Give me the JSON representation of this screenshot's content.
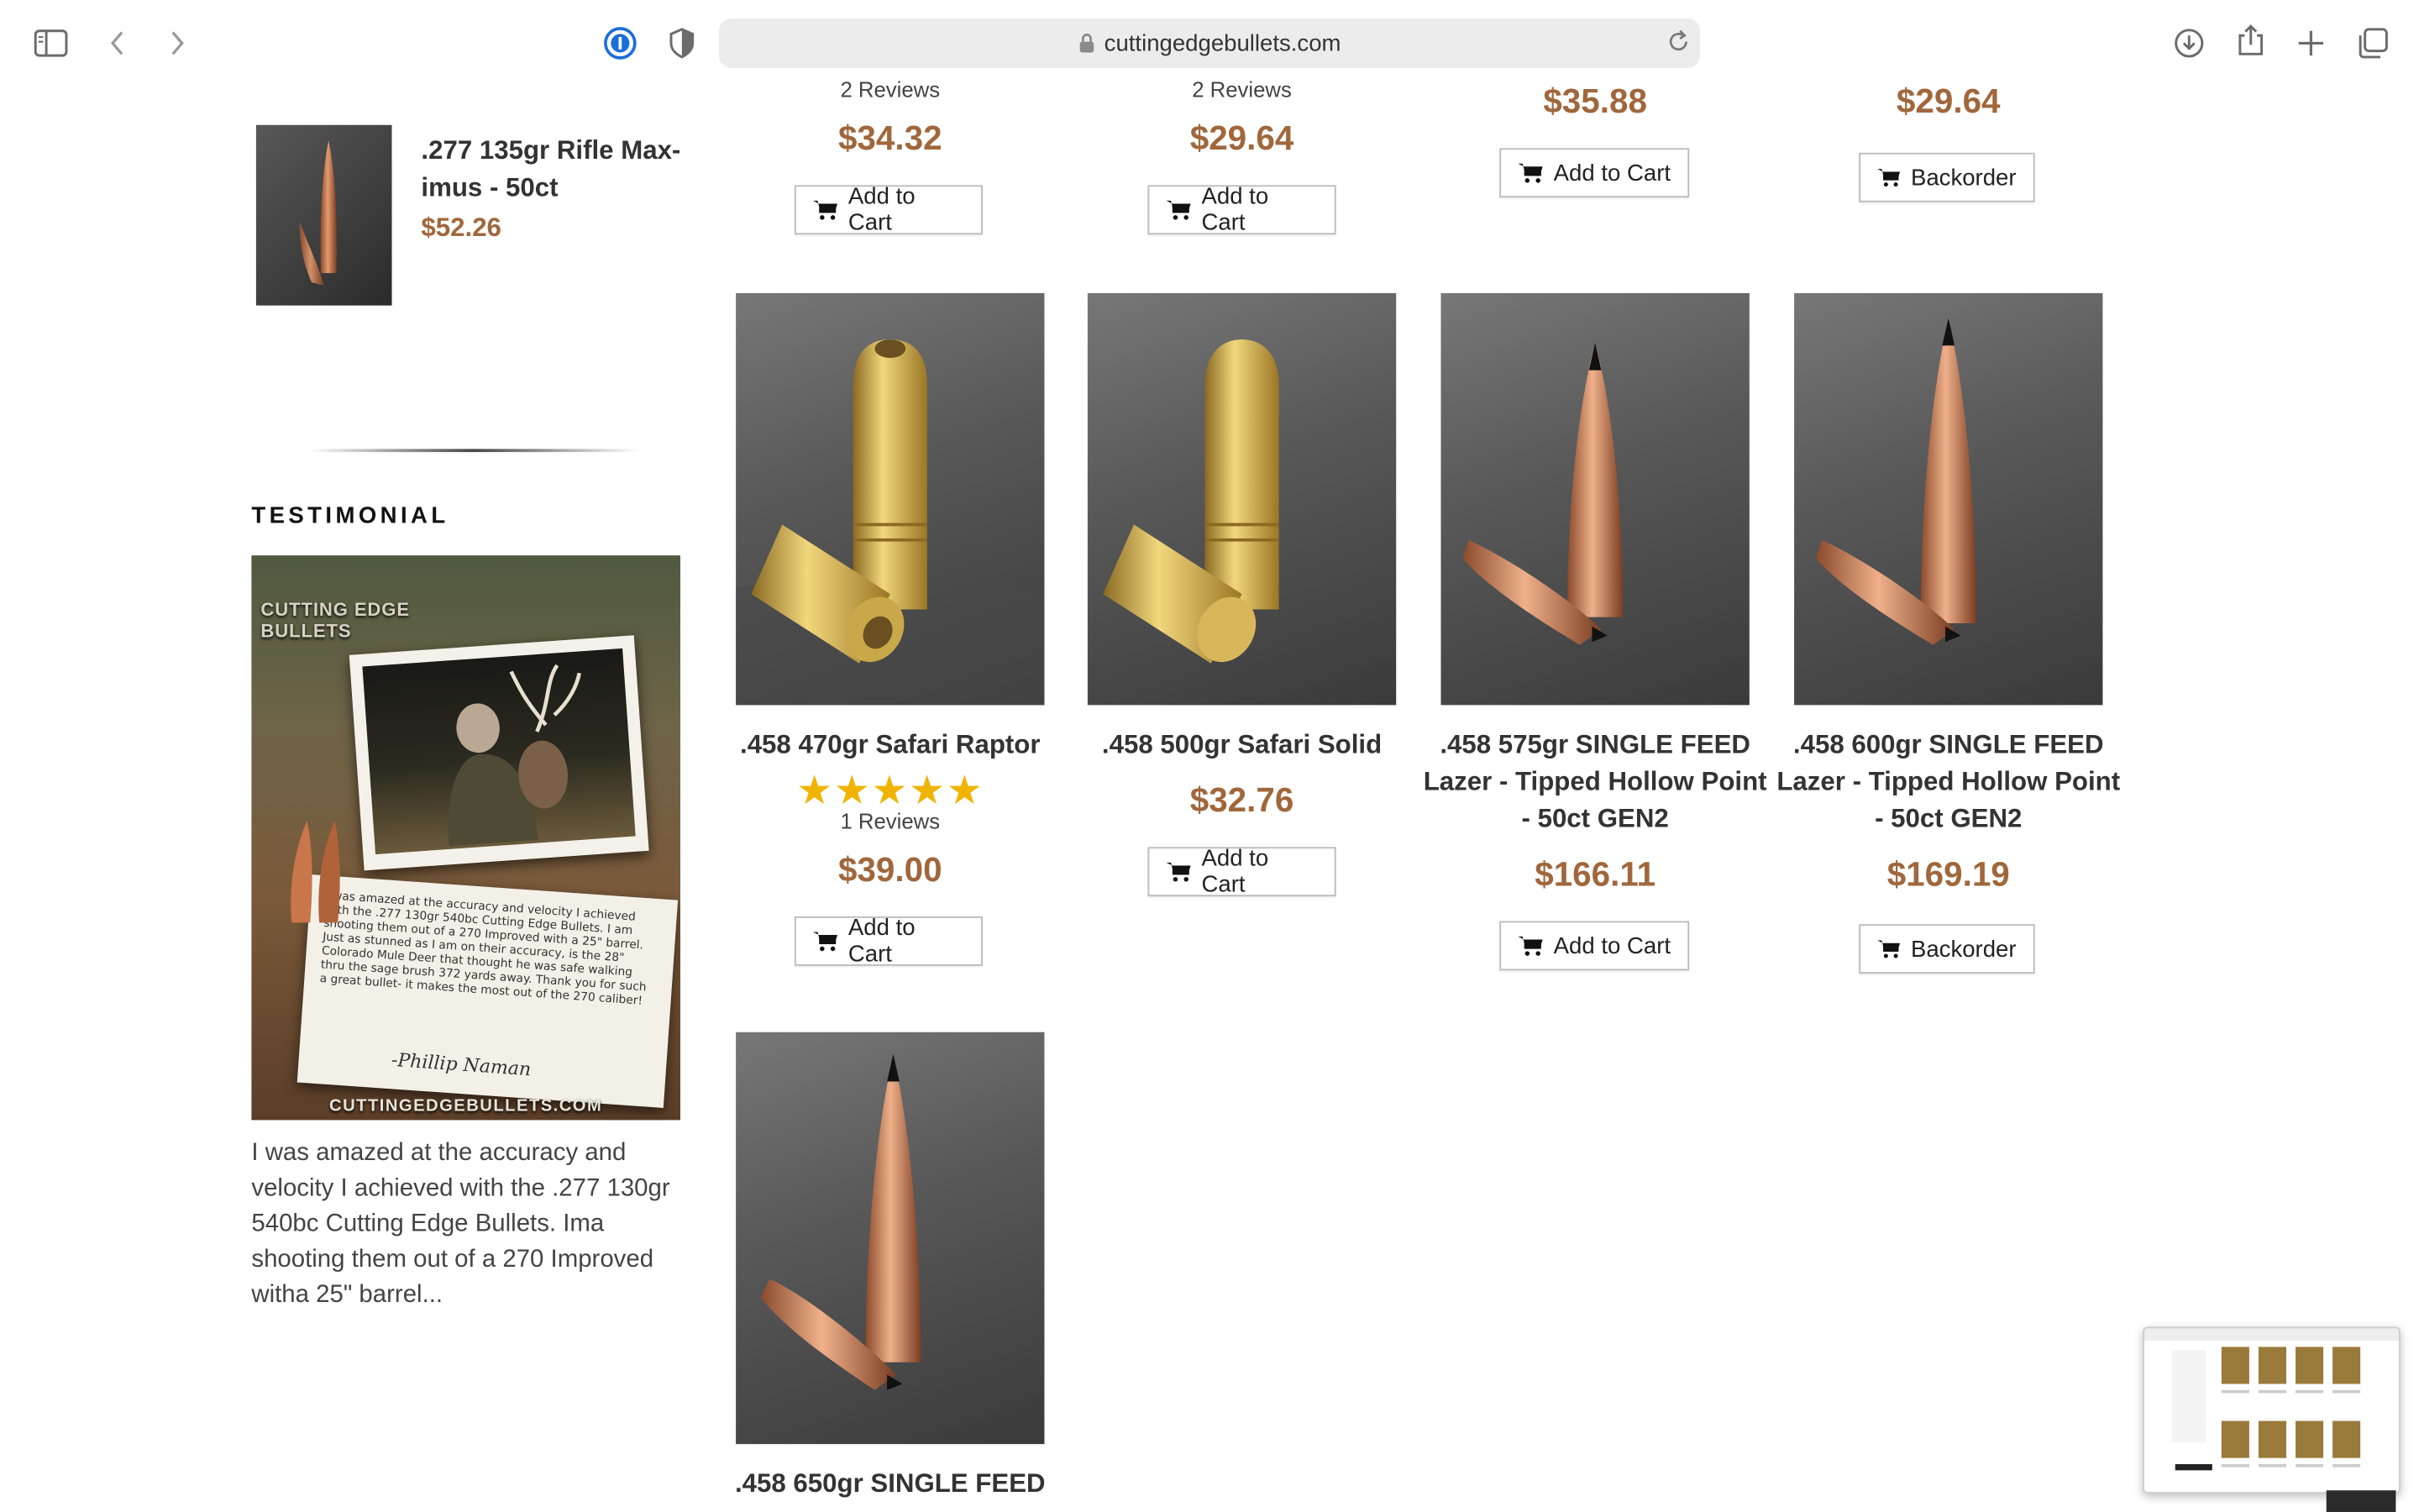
{
  "browser": {
    "url": "cuttingedgebullets.com",
    "icons": [
      "sidebar-icon",
      "back-icon",
      "forward-icon",
      "password-icon",
      "shield-icon",
      "lock-icon",
      "reload-icon",
      "download-icon",
      "share-icon",
      "plus-icon",
      "tabs-icon"
    ]
  },
  "sidebar": {
    "featured": {
      "title": ".277 135gr Rifle Max-imus - 50ct",
      "price": "$52.26"
    },
    "testimonial_heading": "TESTIMONIAL",
    "testimonial_image": {
      "brand": "CUTTING EDGE BULLETS",
      "letter": "I was amazed at the accuracy and velocity I achieved with the .277 130gr 540bc Cutting Edge Bullets. I am shooting them out of a 270 Improved with a 25\" barrel. Just as stunned as I am on their accuracy, is the 28\" Colorado Mule Deer that thought he was safe walking thru the sage brush 372 yards away. Thank you for such a great bullet- it makes the most out of the 270 caliber!",
      "signature": "-Phillip Naman",
      "website": "CUTTINGEDGEBULLETS.COM"
    },
    "testimonial_text": "I was amazed at the accuracy and velocity I achieved with the .277 130gr 540bc Cutting Edge Bullets. Ima shooting them out of a 270 Improved witha 25\" barrel..."
  },
  "top_row": [
    {
      "reviews": "2 Reviews",
      "price": "$34.32",
      "button": "Add to Cart"
    },
    {
      "reviews": "2 Reviews",
      "price": "$29.64",
      "button": "Add to Cart"
    },
    {
      "price": "$35.88",
      "button": "Add to Cart"
    },
    {
      "price": "$29.64",
      "button": "Backorder"
    }
  ],
  "products": [
    {
      "name": ".458 470gr Safari Raptor",
      "stars": "★★★★★",
      "rating": 5,
      "reviews": "1 Reviews",
      "price": "$39.00",
      "button": "Add to Cart"
    },
    {
      "name": ".458 500gr Safari Solid",
      "price": "$32.76",
      "button": "Add to Cart"
    },
    {
      "name": ".458 575gr SINGLE FEED Lazer - Tipped Hollow Point - 50ct GEN2",
      "price": "$166.11",
      "button": "Add to Cart"
    },
    {
      "name": ".458 600gr SINGLE FEED Lazer - Tipped Hollow Point - 50ct GEN2",
      "price": "$169.19",
      "button": "Backorder"
    },
    {
      "name": ".458 650gr SINGLE FEED"
    }
  ]
}
